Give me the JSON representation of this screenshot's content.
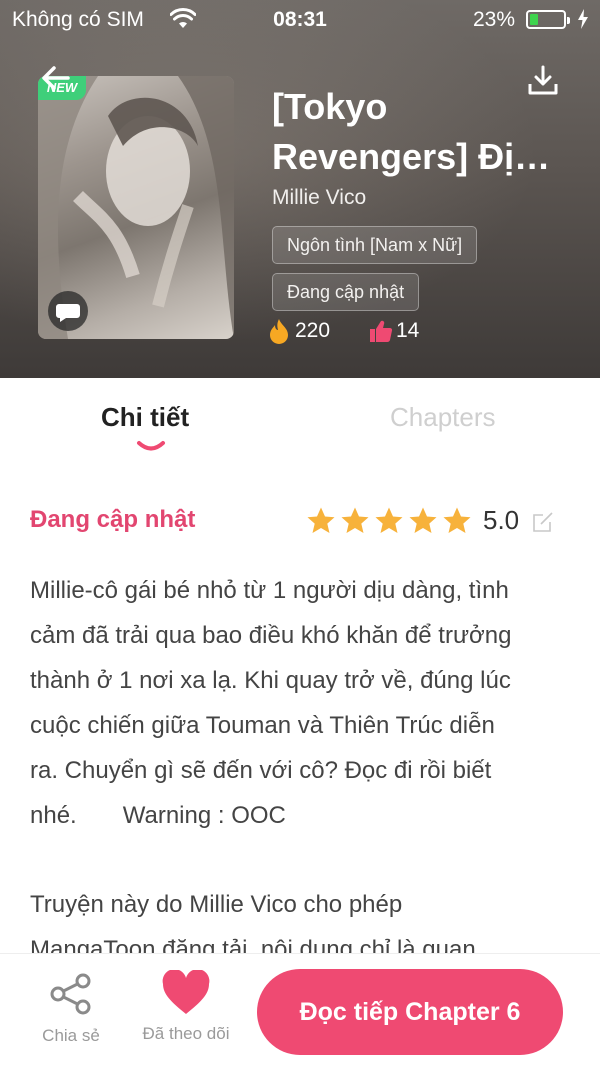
{
  "status_bar": {
    "carrier": "Không có SIM",
    "time": "08:31",
    "battery": "23%",
    "battery_level": 0.23,
    "battery_color": "#3fd34e"
  },
  "header": {
    "back_icon": "arrow-left-icon",
    "download_icon": "download-icon",
    "title": "[Tokyo Revengers] Định Mệnh",
    "author": "Millie Vico",
    "tags": [
      "Ngôn tình [Nam x Nữ]",
      "Đang cập nhật"
    ],
    "badge": "NEW",
    "stats": {
      "fire": "220",
      "likes": "14"
    }
  },
  "tabs": [
    {
      "label": "Chi tiết",
      "active": true
    },
    {
      "label": "Chapters",
      "active": false
    }
  ],
  "detail": {
    "status": "Đang cập nhật",
    "rating": "5.0",
    "stars": 5,
    "description_lines": [
      "Millie-cô gái bé nhỏ từ 1 người dịu dàng, tình",
      "cảm đã trải qua bao điều khó khăn để trưởng",
      "thành ở 1 nơi xa lạ. Khi quay trở về, đúng lúc",
      "cuộc chiến giữa Touman và Thiên Trúc diễn",
      "ra. Chuyển gì sẽ đến với cô? Đọc đi rồi biết",
      "nhé."
    ],
    "warning": "Warning : OOC",
    "notice_lines": [
      "Truyện này do Millie Vico cho phép",
      "MangaToon đăng tải, nội dung chỉ là quan"
    ]
  },
  "bottom_bar": {
    "share_label": "Chia sẻ",
    "follow_label": "Đã theo dõi",
    "continue_label": "Đọc tiếp Chapter 6"
  },
  "colors": {
    "accent": "#ef4a72",
    "status_text": "#e24670",
    "star": "#f7b23b"
  }
}
